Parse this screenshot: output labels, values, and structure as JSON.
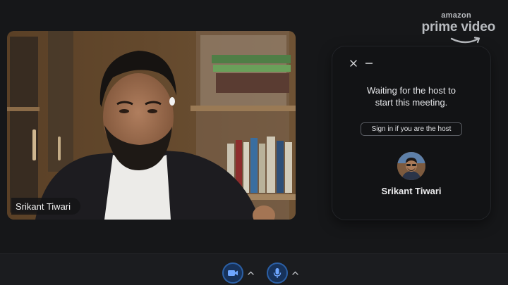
{
  "watermark": {
    "brand_top": "amazon",
    "brand_main": "prime video"
  },
  "video": {
    "participant_name": "Srikant Tiwari"
  },
  "waiting_panel": {
    "message_line1": "Waiting for the host to",
    "message_line2": "start this meeting.",
    "signin_label": "Sign in if you are the host",
    "host_name": "Srikant Tiwari"
  },
  "toolbar": {
    "icons": [
      "camera-icon",
      "microphone-icon"
    ]
  },
  "colors": {
    "background": "#161719",
    "panel": "#121315",
    "toolbar_button": "#17325a",
    "toolbar_button_border": "#2b5fa5"
  }
}
